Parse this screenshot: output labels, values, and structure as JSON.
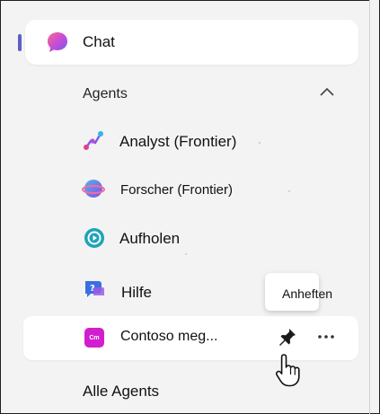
{
  "sidebar": {
    "chat": {
      "label": "Chat",
      "icon": "copilot-chat-icon",
      "active": true
    },
    "agents_section": {
      "label": "Agents",
      "icon": "chevron-up-icon"
    },
    "agents": [
      {
        "label": "Analyst (Frontier)",
        "icon": "analyst-icon"
      },
      {
        "label": "Forscher (Frontier)",
        "icon": "researcher-icon"
      },
      {
        "label": "Aufholen",
        "icon": "catch-up-icon"
      },
      {
        "label": "Hilfe",
        "icon": "help-icon"
      }
    ],
    "contoso": {
      "label": "Contoso meg...",
      "icon_text": "Cm",
      "pin_icon": "pin-icon",
      "more_icon": "more-options-icon"
    },
    "tooltip": {
      "label": "Anheften"
    },
    "all_agents": {
      "label": "Alle Agents"
    }
  },
  "colors": {
    "background": "#f3f3f3",
    "active_indicator": "#5b5fc7",
    "contoso_icon": "#d11fd0",
    "surface": "#ffffff"
  }
}
